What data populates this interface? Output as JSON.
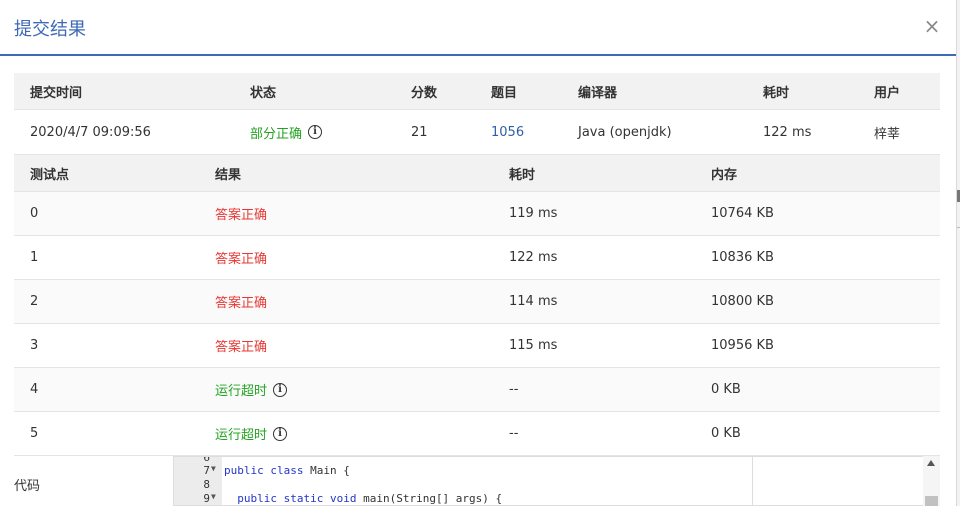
{
  "dialog": {
    "title": "提交结果",
    "close_symbol": "×"
  },
  "summary": {
    "headers": [
      "提交时间",
      "状态",
      "分数",
      "题目",
      "编译器",
      "耗时",
      "用户"
    ],
    "time": "2020/4/7 09:09:56",
    "status": "部分正确",
    "score": "21",
    "problem": "1056",
    "compiler": "Java (openjdk)",
    "duration": "122 ms",
    "user": "梓莘"
  },
  "cases": {
    "headers": [
      "测试点",
      "结果",
      "耗时",
      "内存"
    ],
    "rows": [
      {
        "id": "0",
        "result": "答案正确",
        "time": "119 ms",
        "memory": "10764 KB"
      },
      {
        "id": "1",
        "result": "答案正确",
        "time": "122 ms",
        "memory": "10836 KB"
      },
      {
        "id": "2",
        "result": "答案正确",
        "time": "114 ms",
        "memory": "10800 KB"
      },
      {
        "id": "3",
        "result": "答案正确",
        "time": "115 ms",
        "memory": "10956 KB"
      },
      {
        "id": "4",
        "result": "运行超时",
        "time": "--",
        "memory": "0 KB"
      },
      {
        "id": "5",
        "result": "运行超时",
        "time": "--",
        "memory": "0 KB"
      }
    ]
  },
  "code": {
    "label": "代码",
    "lines": [
      {
        "num": "6",
        "text": ""
      },
      {
        "num": "7",
        "text": "public class Main {"
      },
      {
        "num": "8",
        "text": ""
      },
      {
        "num": "9",
        "text": "  public static void main(String[] args) {"
      }
    ]
  },
  "colors": {
    "accent": "#3d6ab5",
    "accepted": "#e53935",
    "timeout": "#23a323",
    "partial": "#23a323",
    "link": "#2f5ea8"
  },
  "icons": {
    "info": "info-icon",
    "close": "close-icon"
  }
}
